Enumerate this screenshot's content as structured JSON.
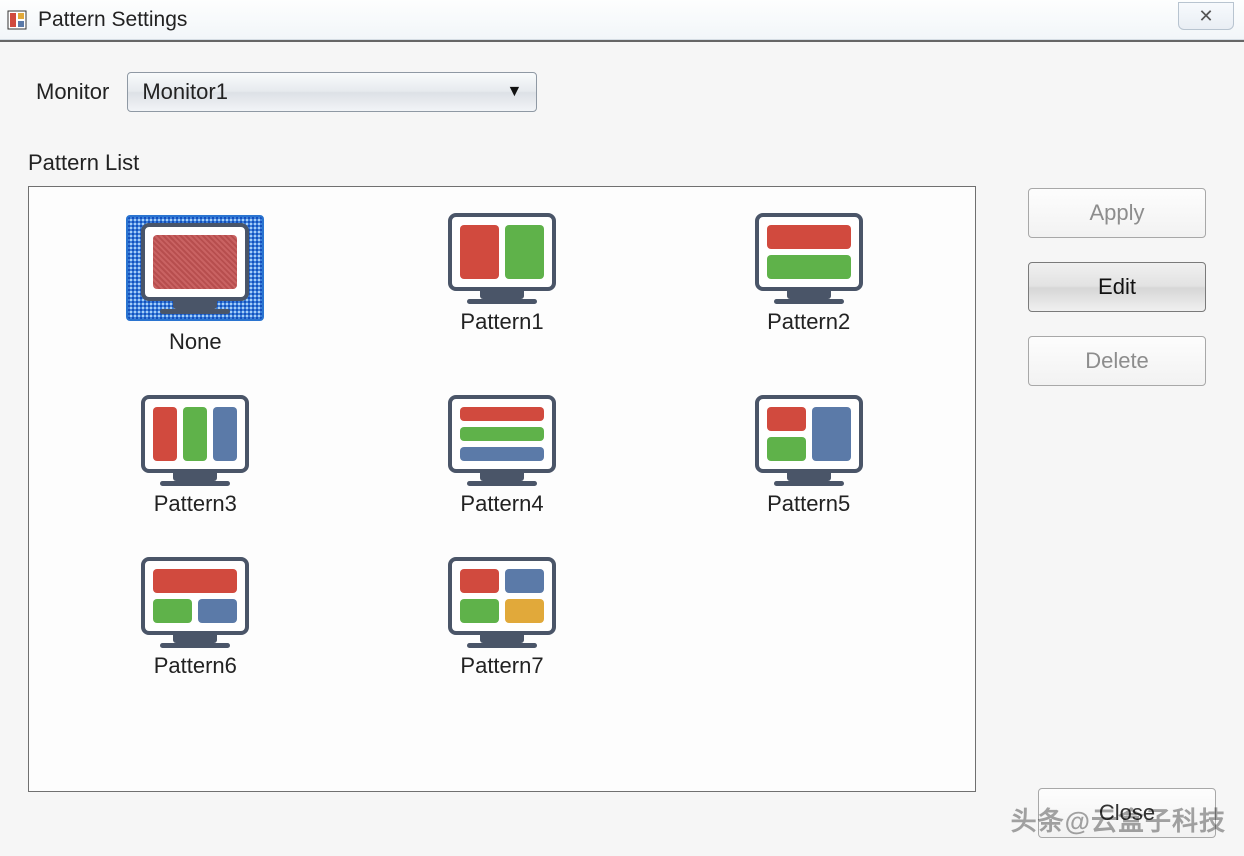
{
  "window": {
    "title": "Pattern Settings",
    "close_glyph": "✕"
  },
  "monitor": {
    "label": "Monitor",
    "selected": "Monitor1"
  },
  "pattern_list": {
    "label": "Pattern List",
    "items": [
      {
        "label": "None",
        "layout": "none",
        "selected": true
      },
      {
        "label": "Pattern1",
        "layout": "2col",
        "selected": false
      },
      {
        "label": "Pattern2",
        "layout": "2row",
        "selected": false
      },
      {
        "label": "Pattern3",
        "layout": "3col",
        "selected": false
      },
      {
        "label": "Pattern4",
        "layout": "3row",
        "selected": false
      },
      {
        "label": "Pattern5",
        "layout": "left1-right2",
        "selected": false
      },
      {
        "label": "Pattern6",
        "layout": "top1-bot2",
        "selected": false
      },
      {
        "label": "Pattern7",
        "layout": "2x2",
        "selected": false
      }
    ]
  },
  "buttons": {
    "apply": {
      "label": "Apply",
      "state": "disabled"
    },
    "edit": {
      "label": "Edit",
      "state": "active"
    },
    "delete": {
      "label": "Delete",
      "state": "disabled"
    },
    "close": {
      "label": "Close",
      "state": "normal"
    }
  },
  "watermark": "头条@云盒子科技",
  "colors": {
    "red": "#d14a3e",
    "green": "#5fb24a",
    "blue": "#5b7aa8",
    "yellow": "#e1a93a",
    "frame": "#4a5568",
    "select_border": "#2a74d0"
  }
}
